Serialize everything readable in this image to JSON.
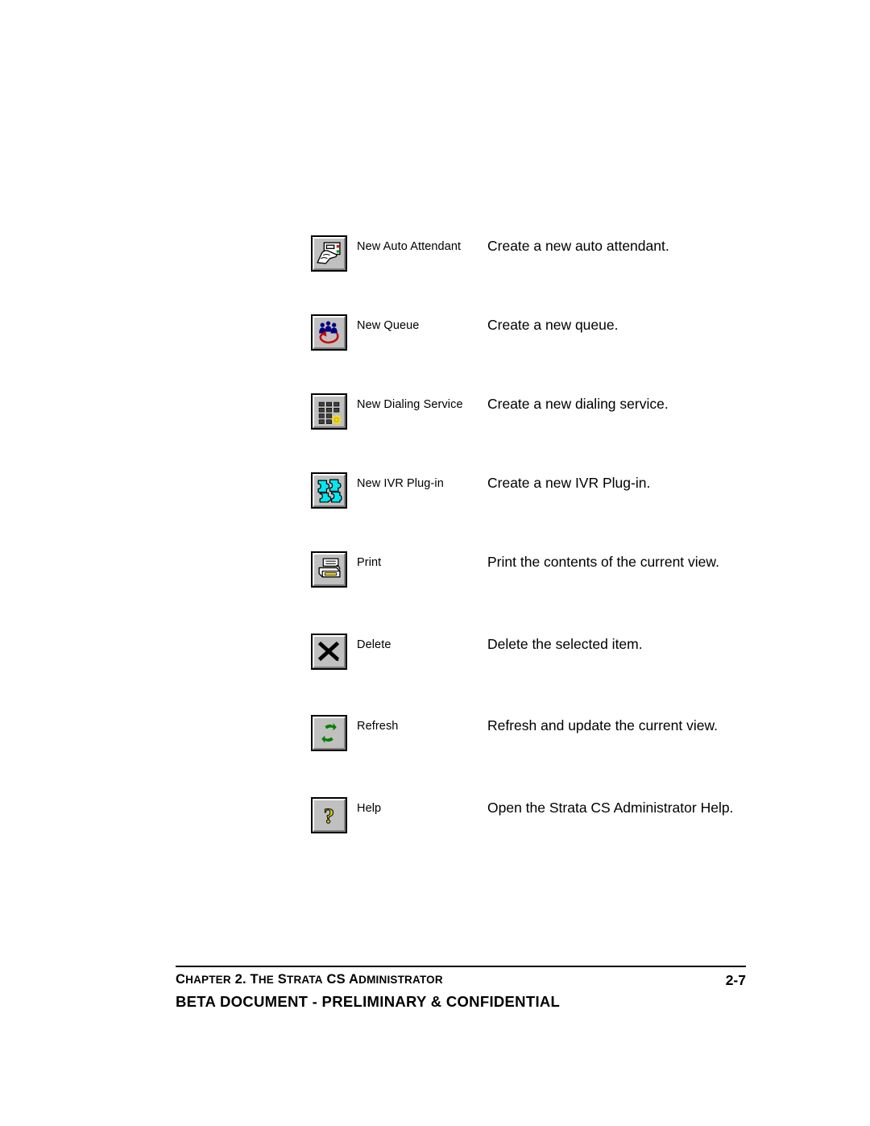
{
  "document": {
    "page_number": "2-7",
    "footer_chapter": "CHAPTER 2. THE STRATA CS ADMINISTRATOR",
    "footer_notice": "BETA DOCUMENT - PRELIMINARY & CONFIDENTIAL"
  },
  "toolbar_table": {
    "rows": [
      {
        "icon": "new-auto-attendant-icon",
        "label": "New Auto Attendant",
        "description": "Create a new auto attendant."
      },
      {
        "icon": "new-queue-icon",
        "label": "New Queue",
        "description": "Create a new queue."
      },
      {
        "icon": "new-dialing-service-icon",
        "label": "New Dialing Service",
        "description": "Create a new dialing service."
      },
      {
        "icon": "new-ivr-plugin-icon",
        "label": "New IVR Plug-in",
        "description": "Create a new IVR Plug-in."
      },
      {
        "icon": "print-icon",
        "label": "Print",
        "description": "Print the contents of the current view."
      },
      {
        "icon": "delete-icon",
        "label": "Delete",
        "description": "Delete the selected item."
      },
      {
        "icon": "refresh-icon",
        "label": "Refresh",
        "description": "Refresh and update the current view."
      },
      {
        "icon": "help-icon",
        "label": "Help",
        "description": "Open the Strata CS Administrator Help."
      }
    ]
  },
  "colors": {
    "button_face": "#c0c0c0",
    "button_highlight": "#ffffff",
    "button_shadow": "#808080",
    "outline": "#000000",
    "queue_people": "#000080",
    "queue_arrow": "#cc0000",
    "keypad_spark": "#ffe100",
    "puzzle": "#00e8f0",
    "printer_tray": "#ffe100",
    "refresh_arrows": "#008000",
    "help_question": "#d8d000"
  }
}
